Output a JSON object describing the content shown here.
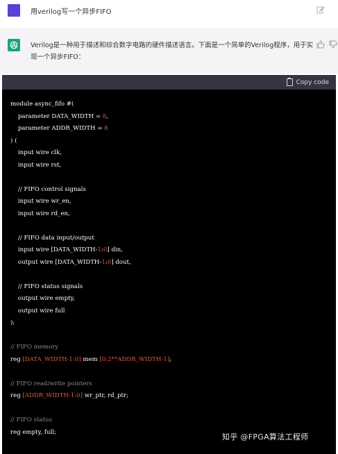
{
  "user_message": {
    "text": "用verilog写一个异步FIFO",
    "avatar_color": "#5b3fd6"
  },
  "assistant_message": {
    "text": "Verilog是一种用于描述和综合数字电路的硬件描述语言。下面是一个简单的Verilog程序，用于实现一个异步FIFO：",
    "avatar_color": "#19a37f"
  },
  "code": {
    "copy_label": "Copy code",
    "lines": [
      [
        {
          "t": "module async_fifo #("
        }
      ],
      [
        {
          "t": "    parameter DATA_WIDTH = "
        },
        {
          "t": "8",
          "c": "t-num"
        },
        {
          "t": ","
        }
      ],
      [
        {
          "t": "    parameter ADDR_WIDTH = "
        },
        {
          "t": "8",
          "c": "t-num"
        }
      ],
      [
        {
          "t": ") ("
        }
      ],
      [
        {
          "t": "    input wire clk,"
        }
      ],
      [
        {
          "t": "    input wire rst,"
        }
      ],
      [],
      [
        {
          "t": "    // FIFO control signals"
        }
      ],
      [
        {
          "t": "    input wire wr_en,"
        }
      ],
      [
        {
          "t": "    input wire rd_en,"
        }
      ],
      [],
      [
        {
          "t": "    // FIFO data input/output"
        }
      ],
      [
        {
          "t": "    input wire [DATA_WIDTH-"
        },
        {
          "t": "1",
          "c": "t-num"
        },
        {
          "t": ":"
        },
        {
          "t": "0",
          "c": "t-num"
        },
        {
          "t": "] din,"
        }
      ],
      [
        {
          "t": "    output wire [DATA_WIDTH-"
        },
        {
          "t": "1",
          "c": "t-num"
        },
        {
          "t": ":"
        },
        {
          "t": "0",
          "c": "t-num"
        },
        {
          "t": "] dout,"
        }
      ],
      [],
      [
        {
          "t": "    // FIFO status signals"
        }
      ],
      [
        {
          "t": "    output wire empty,"
        }
      ],
      [
        {
          "t": "    output wire full"
        }
      ],
      [
        {
          "t": ");"
        }
      ],
      [],
      [
        {
          "t": "// FIFO memory",
          "c": "t-cmt"
        }
      ],
      [
        {
          "t": "reg "
        },
        {
          "t": "[DATA_WIDTH-1:0]",
          "c": "t-num"
        },
        {
          "t": " mem "
        },
        {
          "t": "[0:2**ADDR_WIDTH-1]",
          "c": "t-num"
        },
        {
          "t": ";"
        }
      ],
      [],
      [
        {
          "t": "// FIFO read/write pointers",
          "c": "t-cmt"
        }
      ],
      [
        {
          "t": "reg "
        },
        {
          "t": "[ADDR_WIDTH-1:0]",
          "c": "t-num"
        },
        {
          "t": " wr_ptr, rd_ptr;"
        }
      ],
      [],
      [
        {
          "t": "// FIFO status",
          "c": "t-cmt"
        }
      ],
      [
        {
          "t": "reg empty, full;"
        }
      ]
    ]
  },
  "watermark": "知乎 @FPGA算法工程师"
}
